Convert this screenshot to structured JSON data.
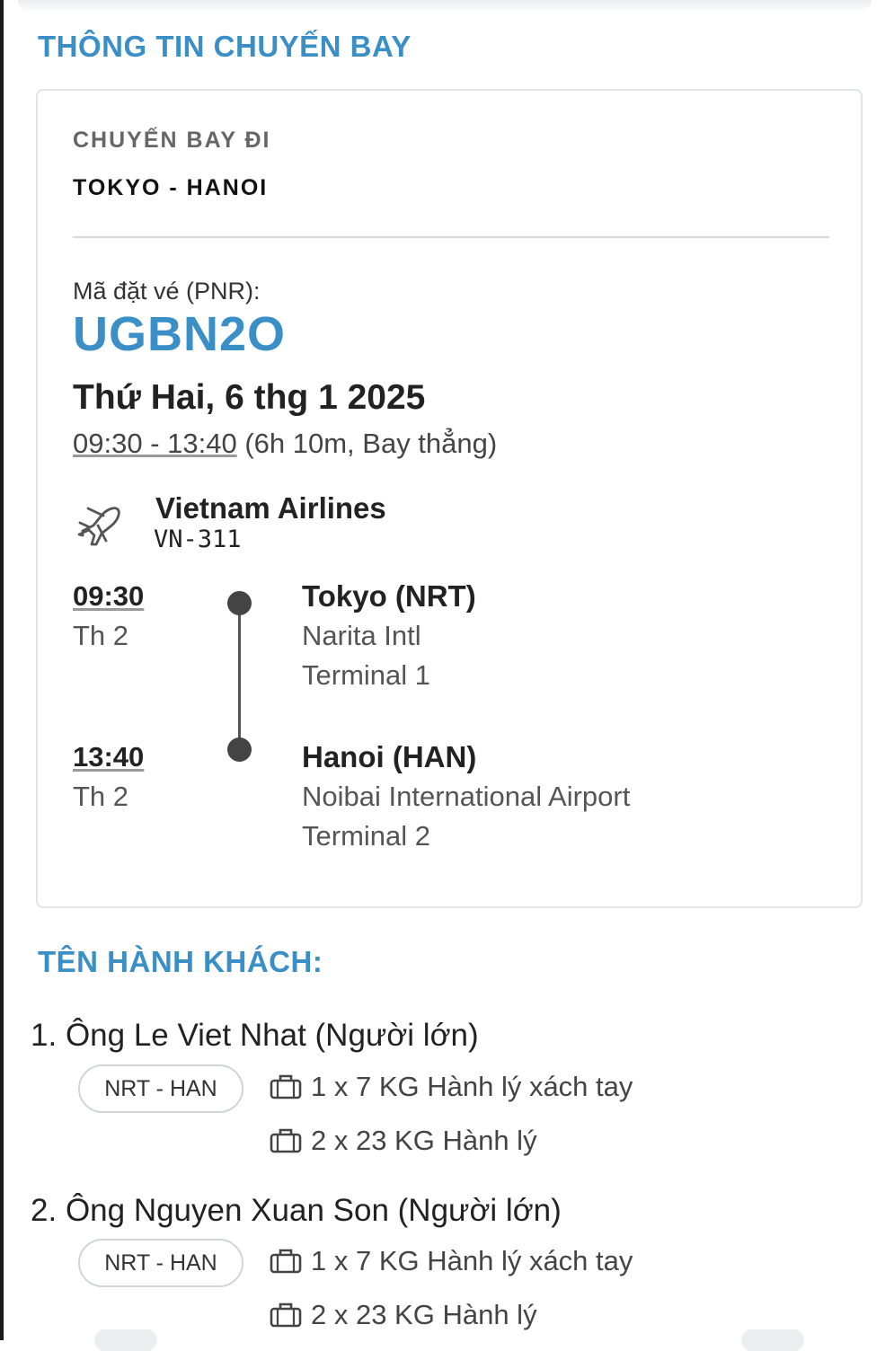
{
  "flight_info": {
    "section_title": "THÔNG TIN CHUYẾN BAY",
    "direction_label": "CHUYẾN BAY ĐI",
    "route": "TOKYO - HANOI",
    "pnr_label": "Mã đặt vé (PNR):",
    "pnr_code": "UGBN2O",
    "date": "Thứ Hai, 6 thg 1 2025",
    "time_range": "09:30 - 13:40",
    "duration_info": "(6h 10m, Bay thẳng)",
    "airline": "Vietnam Airlines",
    "flight_number": "VN-311",
    "departure": {
      "time": "09:30",
      "day": "Th 2",
      "city": "Tokyo (NRT)",
      "airport": "Narita Intl",
      "terminal": "Terminal 1"
    },
    "arrival": {
      "time": "13:40",
      "day": "Th 2",
      "city": "Hanoi (HAN)",
      "airport": "Noibai International Airport",
      "terminal": "Terminal 2"
    }
  },
  "passengers": {
    "section_title": "TÊN HÀNH KHÁCH:",
    "list": [
      {
        "index": "1.",
        "name": "Ông Le Viet Nhat (Người lớn)",
        "route": "NRT - HAN",
        "carry_on": "1 x 7 KG Hành lý xách tay",
        "checked": "2 x 23 KG Hành lý"
      },
      {
        "index": "2.",
        "name": "Ông Nguyen Xuan Son (Người lớn)",
        "route": "NRT - HAN",
        "carry_on": "1 x 7 KG Hành lý xách tay",
        "checked": "2 x 23 KG Hành lý"
      }
    ]
  },
  "icons": {
    "airline": "airplane-icon",
    "baggage": "luggage-icon",
    "timeline": "timeline-dot"
  },
  "colors": {
    "accent": "#3a8fc6",
    "text": "#222222",
    "muted": "#555555",
    "border": "#e2e5e8"
  }
}
